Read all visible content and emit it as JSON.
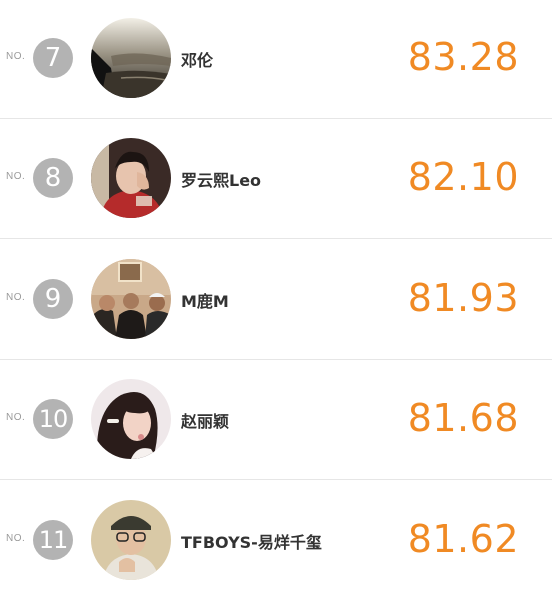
{
  "no_prefix": "NO.",
  "entries": [
    {
      "rank": "7",
      "name": "邓伦",
      "score": "83.28",
      "avatar": "avatar-dark-landscape"
    },
    {
      "rank": "8",
      "name": "罗云熙Leo",
      "score": "82.10",
      "avatar": "avatar-person-red"
    },
    {
      "rank": "9",
      "name": "M鹿M",
      "score": "81.93",
      "avatar": "avatar-group-photo"
    },
    {
      "rank": "10",
      "name": "赵丽颖",
      "score": "81.68",
      "avatar": "avatar-woman-hairclip"
    },
    {
      "rank": "11",
      "name": "TFBOYS-易烊千玺",
      "score": "81.62",
      "avatar": "avatar-boy-hat"
    }
  ],
  "colors": {
    "score": "#f08a24",
    "badge": "#b3b3b3",
    "name": "#333333",
    "divider": "#e6e6e6"
  }
}
